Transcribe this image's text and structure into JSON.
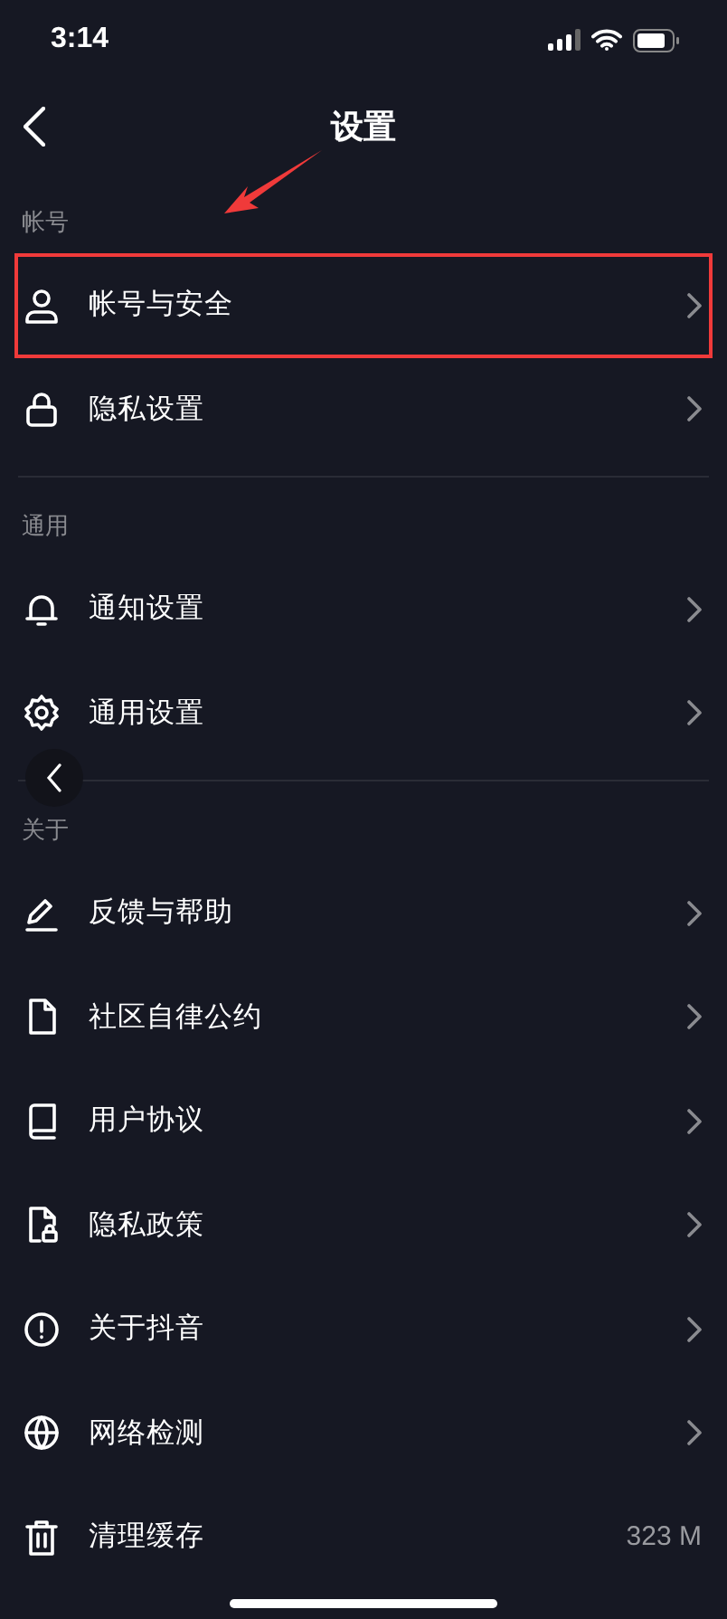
{
  "status_bar": {
    "time": "3:14"
  },
  "nav": {
    "title": "设置"
  },
  "sections": [
    {
      "header": "帐号",
      "items": [
        {
          "label": "帐号与安全",
          "highlighted": true,
          "chevron": true
        },
        {
          "label": "隐私设置",
          "highlighted": false,
          "chevron": true
        }
      ]
    },
    {
      "header": "通用",
      "items": [
        {
          "label": "通知设置",
          "highlighted": false,
          "chevron": true
        },
        {
          "label": "通用设置",
          "highlighted": false,
          "chevron": true
        }
      ]
    },
    {
      "header": "关于",
      "items": [
        {
          "label": "反馈与帮助",
          "highlighted": false,
          "chevron": true
        },
        {
          "label": "社区自律公约",
          "highlighted": false,
          "chevron": true
        },
        {
          "label": "用户协议",
          "highlighted": false,
          "chevron": true
        },
        {
          "label": "隐私政策",
          "highlighted": false,
          "chevron": true
        },
        {
          "label": "关于抖音",
          "highlighted": false,
          "chevron": true
        },
        {
          "label": "网络检测",
          "highlighted": false,
          "chevron": true
        },
        {
          "label": "清理缓存",
          "highlighted": false,
          "chevron": false,
          "value": "323 M"
        }
      ]
    }
  ]
}
